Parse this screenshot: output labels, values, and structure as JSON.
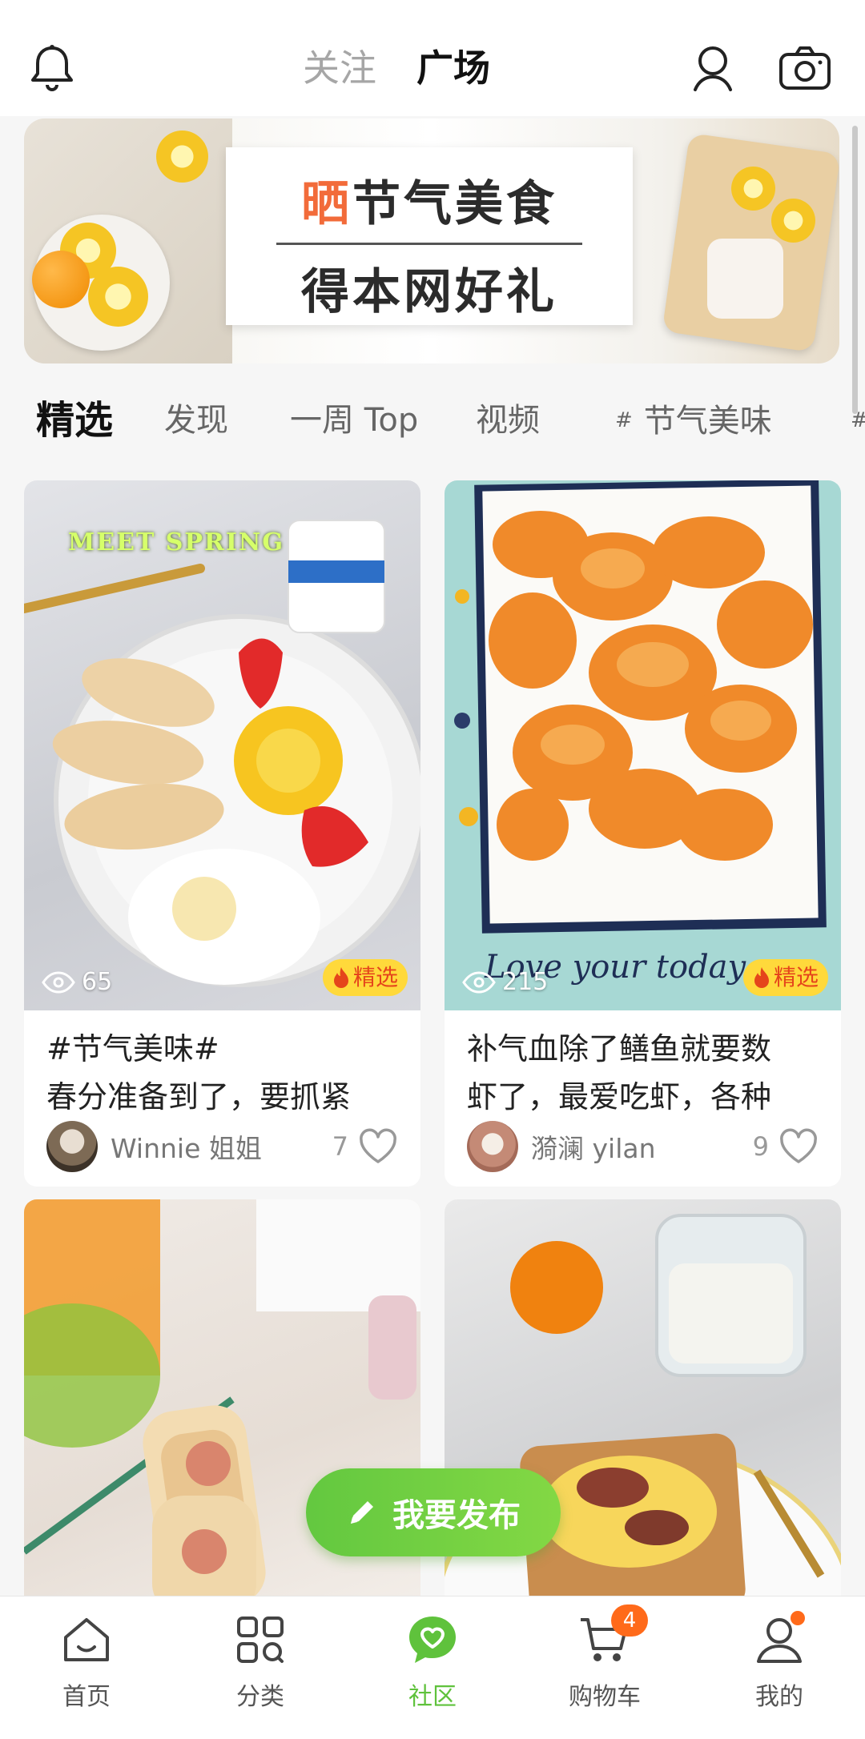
{
  "header": {
    "tabs": [
      {
        "label": "关注"
      },
      {
        "label": "广场"
      }
    ],
    "icons": [
      "bell-icon",
      "user-icon",
      "camera-icon"
    ]
  },
  "banner": {
    "line1_highlight": "晒",
    "line1_rest": "节气美食",
    "line2": "得本网好礼"
  },
  "category_tabs": [
    {
      "label": "精选",
      "active": true
    },
    {
      "label": "发现"
    },
    {
      "label": "一周 Top"
    },
    {
      "label": "视频"
    },
    {
      "label": "节气美味",
      "hashtag": "#"
    },
    {
      "label": "",
      "hashtag": "#"
    }
  ],
  "feed": [
    {
      "image_text": "MEET SPRING",
      "views": "65",
      "badge": "精选",
      "title_line1": "#节气美味#",
      "title_line2": "春分准备到了，要抓紧",
      "author": "Winnie 姐姐",
      "likes": "7"
    },
    {
      "image_text": "Love your today",
      "views": "215",
      "badge": "精选",
      "title_line1": "补气血除了鳝鱼就要数",
      "title_line2": "虾了，最爱吃虾，各种",
      "author": "漪澜 yilan",
      "likes": "9"
    }
  ],
  "publish_button": {
    "label": "我要发布"
  },
  "bottom_nav": [
    {
      "label": "首页",
      "icon": "home-icon"
    },
    {
      "label": "分类",
      "icon": "grid-icon"
    },
    {
      "label": "社区",
      "icon": "community-icon",
      "active": true
    },
    {
      "label": "购物车",
      "icon": "cart-icon",
      "badge": "4"
    },
    {
      "label": "我的",
      "icon": "profile-icon"
    }
  ],
  "colors": {
    "accent_green": "#5fc23c",
    "badge_orange": "#ff6a1a",
    "highlight_orange": "#f26b3a",
    "badge_yellow": "#ffd93b"
  }
}
